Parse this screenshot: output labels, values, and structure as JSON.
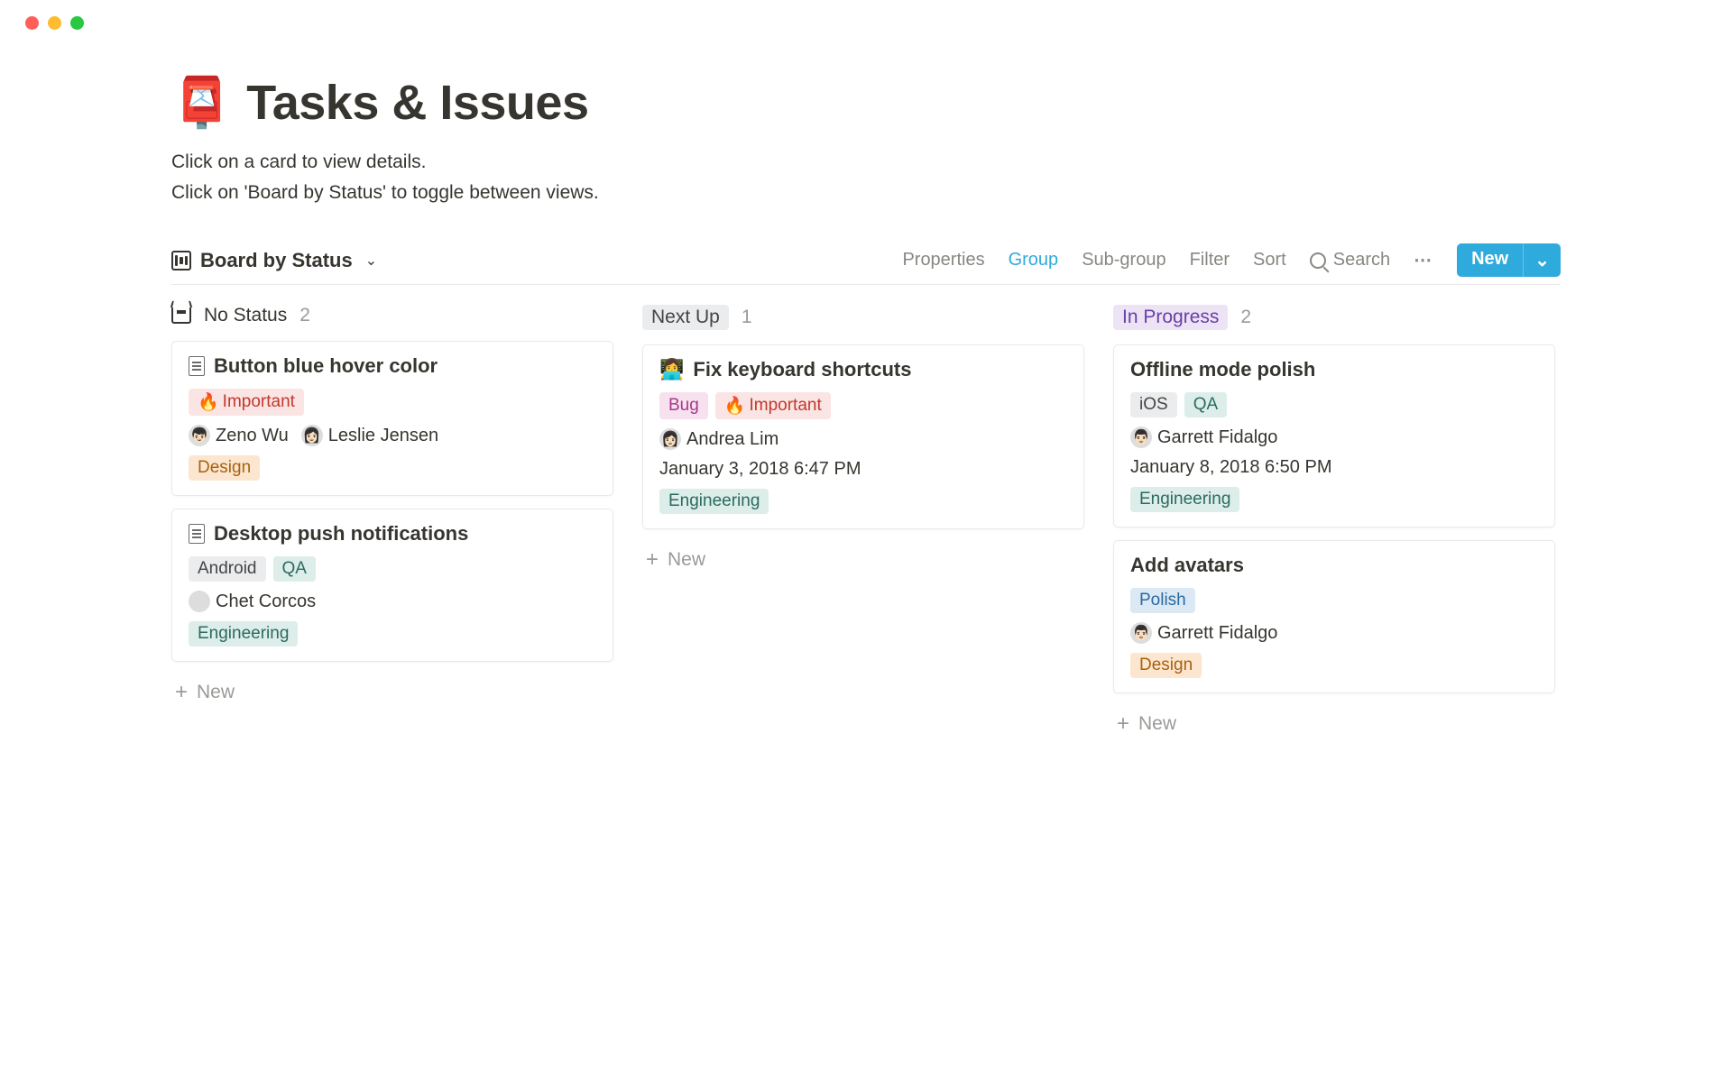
{
  "header": {
    "icon": "📮",
    "title": "Tasks & Issues",
    "description_line1": "Click on a card to view details.",
    "description_line2": "Click on 'Board by Status' to toggle between views."
  },
  "viewbar": {
    "view_name": "Board by Status",
    "actions": {
      "properties": "Properties",
      "group": "Group",
      "subgroup": "Sub-group",
      "filter": "Filter",
      "sort": "Sort",
      "search": "Search",
      "new": "New"
    }
  },
  "columns": [
    {
      "id": "no-status",
      "has_icon": true,
      "title": "No Status",
      "title_style": "plain",
      "count": "2",
      "cards": [
        {
          "icon_type": "doc",
          "title": "Button blue hover color",
          "tags_top": [
            {
              "emoji": "🔥",
              "label": "Important",
              "color": "c-red-light"
            }
          ],
          "people": [
            {
              "avatar": "👦🏻",
              "name": "Zeno Wu"
            },
            {
              "avatar": "👩🏻",
              "name": "Leslie Jensen"
            }
          ],
          "date": "",
          "tags_bottom": [
            {
              "label": "Design",
              "color": "c-orange-light"
            }
          ]
        },
        {
          "icon_type": "doc",
          "title": "Desktop push notifications",
          "tags_top": [
            {
              "label": "Android",
              "color": "c-gray-light"
            },
            {
              "label": "QA",
              "color": "c-green-light"
            }
          ],
          "people": [
            {
              "avatar": "",
              "name": "Chet Corcos"
            }
          ],
          "date": "",
          "tags_bottom": [
            {
              "label": "Engineering",
              "color": "c-green-light"
            }
          ]
        }
      ],
      "new_label": "New"
    },
    {
      "id": "next-up",
      "has_icon": false,
      "title": "Next Up",
      "title_style": "tag",
      "title_tag_color": "c-gray-light",
      "count": "1",
      "cards": [
        {
          "icon_type": "emoji",
          "icon_emoji": "👩‍💻",
          "title": "Fix keyboard shortcuts",
          "tags_top": [
            {
              "label": "Bug",
              "color": "c-pink-light"
            },
            {
              "emoji": "🔥",
              "label": "Important",
              "color": "c-red-light"
            }
          ],
          "people": [
            {
              "avatar": "👩🏻",
              "name": "Andrea Lim"
            }
          ],
          "date": "January 3, 2018 6:47 PM",
          "tags_bottom": [
            {
              "label": "Engineering",
              "color": "c-green-light"
            }
          ]
        }
      ],
      "new_label": "New"
    },
    {
      "id": "in-progress",
      "has_icon": false,
      "title": "In Progress",
      "title_style": "tag",
      "title_tag_color": "c-purple-light",
      "count": "2",
      "cards": [
        {
          "icon_type": "none",
          "title": "Offline mode polish",
          "tags_top": [
            {
              "label": "iOS",
              "color": "c-gray-light"
            },
            {
              "label": "QA",
              "color": "c-green-light"
            }
          ],
          "people": [
            {
              "avatar": "👨🏻",
              "name": "Garrett Fidalgo"
            }
          ],
          "date": "January 8, 2018 6:50 PM",
          "tags_bottom": [
            {
              "label": "Engineering",
              "color": "c-green-light"
            }
          ]
        },
        {
          "icon_type": "none",
          "title": "Add avatars",
          "tags_top": [
            {
              "label": "Polish",
              "color": "c-blue-light"
            }
          ],
          "people": [
            {
              "avatar": "👨🏻",
              "name": "Garrett Fidalgo"
            }
          ],
          "date": "",
          "tags_bottom": [
            {
              "label": "Design",
              "color": "c-orange-light"
            }
          ]
        }
      ],
      "new_label": "New"
    }
  ]
}
